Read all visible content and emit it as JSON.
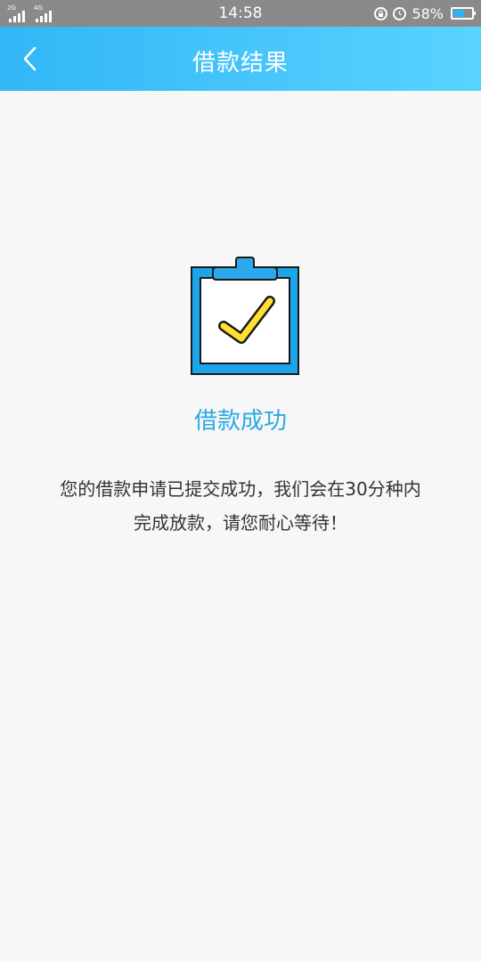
{
  "status_bar": {
    "sim1_network": "2G",
    "sim2_network": "4G",
    "time": "14:58",
    "battery_percent": "58%",
    "battery_level": 0.58,
    "icons": [
      "signal-icon",
      "lock-rotation-icon",
      "alarm-icon",
      "battery-icon"
    ]
  },
  "header": {
    "title": "借款结果",
    "back_icon": "chevron-left-icon",
    "gradient_from": "#32b6f6",
    "gradient_to": "#59d3ff"
  },
  "result": {
    "icon": "clipboard-check-icon",
    "title": "借款成功",
    "description": "您的借款申请已提交成功，我们会在30分种内完成放款，请您耐心等待！",
    "accent_color": "#2ba8e5",
    "check_color": "#ffe02f"
  }
}
